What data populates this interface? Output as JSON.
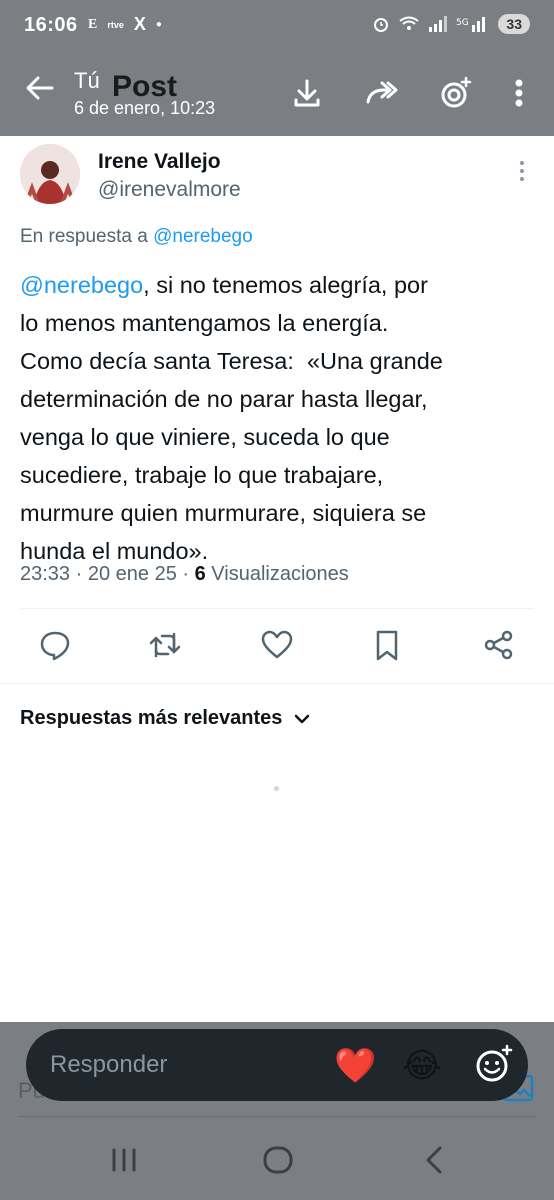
{
  "status_bar": {
    "time": "16:06",
    "app_icons": [
      "E",
      "rtve",
      "X"
    ],
    "battery": "33"
  },
  "header": {
    "user_label": "Tú",
    "title": "Post",
    "date": "6 de enero, 10:23"
  },
  "tweet": {
    "author_name": "Irene Vallejo",
    "author_handle": "@irenevalmore",
    "reply_prefix": "En respuesta a ",
    "reply_handle": "@nerebego",
    "body_mention": "@nerebego",
    "body_text": ", si no tenemos alegría, por\nlo menos mantengamos la energía.\nComo decía santa Teresa:  «Una grande\ndeterminación de no parar hasta llegar,\nvenga lo que viniere, suceda lo que\nsucediere, trabaje lo que trabajare,\nmurmure quien murmurare, siquiera se\nhunda el mundo».",
    "time": "23:33",
    "date": "20 ene 25",
    "views_count": "6",
    "views_label": "Visualizaciones"
  },
  "actions": [
    "reply-icon",
    "retweet-icon",
    "like-icon",
    "bookmark-icon",
    "share-icon"
  ],
  "replies": {
    "sort_label": "Respuestas más relevantes"
  },
  "composer": {
    "placeholder": "Responder",
    "underlying_placeholder": "Pu",
    "emojis": [
      "❤️",
      "😂"
    ]
  },
  "colors": {
    "accent": "#1d9bf0",
    "secondary_text": "#536471",
    "overlay": "#7b7f84",
    "composer_bg": "#1f272d"
  }
}
